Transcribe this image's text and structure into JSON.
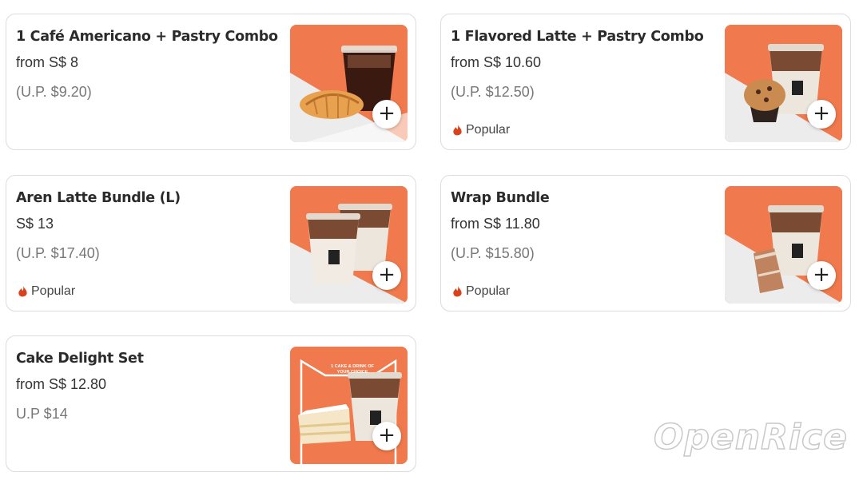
{
  "colors": {
    "accent": "#f07a4d",
    "popular": "#d8431e",
    "border": "#dcdcdc"
  },
  "items": [
    {
      "title": "1 Café Americano + Pastry Combo",
      "price": "from S$ 8",
      "original_price": "(U.P. $9.20)",
      "badge": "",
      "image": "iced-americano-croissant",
      "add_label": "+"
    },
    {
      "title": "1 Flavored Latte + Pastry Combo",
      "price": "from S$ 10.60",
      "original_price": "(U.P. $12.50)",
      "badge": "Popular",
      "image": "latte-muffin",
      "add_label": "+"
    },
    {
      "title": "Aren Latte Bundle (L)",
      "price": "S$ 13",
      "original_price": "(U.P. $17.40)",
      "badge": "Popular",
      "image": "two-lattes",
      "add_label": "+"
    },
    {
      "title": "Wrap Bundle",
      "price": "from S$ 11.80",
      "original_price": "(U.P. $15.80)",
      "badge": "Popular",
      "image": "latte-wrap",
      "add_label": "+"
    },
    {
      "title": "Cake Delight Set",
      "price": "from S$ 12.80",
      "original_price": "U.P $14",
      "badge": "",
      "image": "latte-cake",
      "add_label": "+",
      "image_text": "1 CAKE & DRINK OF YOUR CHOICE"
    }
  ],
  "watermark": "OpenRice"
}
